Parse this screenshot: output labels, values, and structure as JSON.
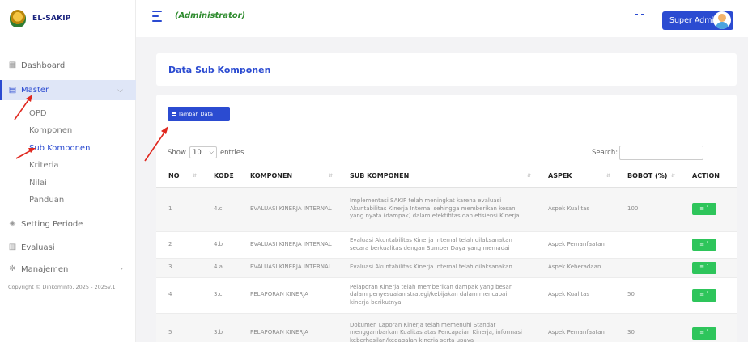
{
  "app": {
    "brand": "EL-SAKIP"
  },
  "sidebar": {
    "items": [
      {
        "label": "Dashboard",
        "icon": "dashboard-icon"
      },
      {
        "label": "Master",
        "icon": "master-icon"
      },
      {
        "label": "Setting Periode",
        "icon": "layers-icon"
      },
      {
        "label": "Evaluasi",
        "icon": "document-icon"
      },
      {
        "label": "Manajemen",
        "icon": "gear-icon"
      }
    ],
    "submenu": [
      "OPD",
      "Komponen",
      "Sub Komponen",
      "Kriteria",
      "Nilai",
      "Panduan"
    ],
    "copyright": "Copyright © Dinkominfo, 2025 - 2025v.1"
  },
  "topbar": {
    "role": "(Administrator)",
    "user_button": "Super Admin"
  },
  "page": {
    "title": "Data Sub Komponen",
    "add_button": "Tambah Data"
  },
  "table_controls": {
    "show_label": "Show",
    "entries_value": "10",
    "entries_label": "entries",
    "search_label": "Search:"
  },
  "table": {
    "headers": [
      "NO",
      "KODE",
      "KOMPONEN",
      "SUB KOMPONEN",
      "ASPEK",
      "BOBOT (%)",
      "ACTION"
    ],
    "rows": [
      {
        "no": "1",
        "kode": "4.c",
        "komponen": "EVALUASI KINERJA INTERNAL",
        "sub": "Implementasi SAKIP telah meningkat karena evaluasi Akuntabilitas Kinerja Internal sehingga memberikan kesan yang nyata (dampak) dalam efektifitas dan efisiensi Kinerja",
        "aspek": "Aspek Kualitas",
        "bobot": "100"
      },
      {
        "no": "2",
        "kode": "4.b",
        "komponen": "EVALUASI KINERJA INTERNAL",
        "sub": "Evaluasi Akuntabilitas Kinerja Internal telah dilaksanakan secara berkualitas dengan Sumber Daya yang memadai",
        "aspek": "Aspek Pemanfaatan",
        "bobot": ""
      },
      {
        "no": "3",
        "kode": "4.a",
        "komponen": "EVALUASI KINERJA INTERNAL",
        "sub": "Evaluasi Akuntabilitas Kinerja Internal telah dilaksanakan",
        "aspek": "Aspek Keberadaan",
        "bobot": ""
      },
      {
        "no": "4",
        "kode": "3.c",
        "komponen": "PELAPORAN KINERJA",
        "sub": "Pelaporan Kinerja telah memberikan dampak yang besar dalam penyesuaian strategi/kebijakan dalam mencapai kinerja berikutnya",
        "aspek": "Aspek Kualitas",
        "bobot": "50"
      },
      {
        "no": "5",
        "kode": "3.b",
        "komponen": "PELAPORAN KINERJA",
        "sub": "Dokumen Laporan Kinerja telah memenuhi Standar menggambarkan Kualitas atas Pencapaian Kinerja, informasi keberhasilan/kegagalan kinerja serta upaya",
        "aspek": "Aspek Pemanfaatan",
        "bobot": "30"
      }
    ]
  },
  "colors": {
    "primary": "#2b4bd1",
    "action": "#2ec55b",
    "annotation": "#e0281f"
  }
}
